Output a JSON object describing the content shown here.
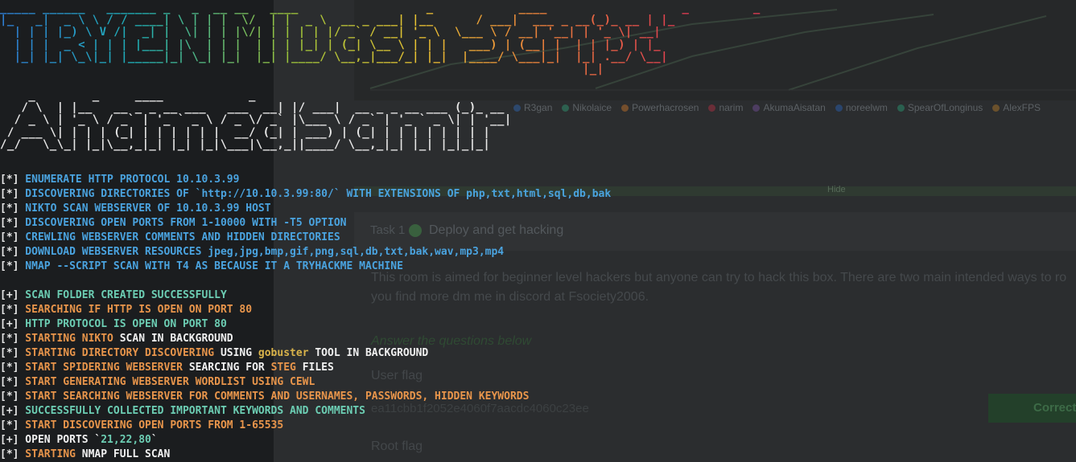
{
  "banner": {
    "line1": "_____ ______   _______ _   _  __ __   ____                  _            ____                   _         _",
    "line2": "|_   _|  _ \\ \\ / / ____| \\ | | |  \\/  | |  _ \\  __ _ ___| |__      / ___|  ___ _ __(_)_ __ | |_",
    "line3": "  | | | |_) \\ V /|  _| |  \\| | | |\\/| | | | | |/ _` / __| '_ \\  \\___ \\ / __| '__| | '_ \\| __|",
    "line4": "  | | |  _ < | | | |___| |\\  | | |  | | | |_| | (_| \\__ \\ | | |   ___) | (__| |  | | |_) | |_",
    "line5": "  |_| |_| \\_\\|_| |_____|_| \\_| |_|  |_| |____/ \\__,_|___/_| |_|  |____/ \\___|_|  |_| .__/ \\__|",
    "line6": "                                                                                  |_|",
    "art2": "    _        _     ____            _\n   / \\  | |__   __ _ _ __ ___   ___  __| |/ ___|  __ _ _ __ ___ (_)_ __\n  / _ \\ | '_ \\ / _` | '_ ` _ \\ / _ \\/ _` |\\___ \\ / _` | '_ ` _ \\| | '__|\n / ___ \\| | | | (_| | | | | | |  __/ (_| | ___) | (_| | | | | | | | |\n/_/   \\_\\_| |_|\\__,_|_| |_| |_|\\___|\\__,_||____/ \\__,_|_| |_| |_|_|_|"
  },
  "terminal": {
    "group1": [
      {
        "prefix": "[*]",
        "segments": [
          {
            "text": " ENUMERATE HTTP PROTOCOL 10.10.3.99",
            "color": "blue"
          }
        ]
      },
      {
        "prefix": "[*]",
        "segments": [
          {
            "text": " DISCOVERING DIRECTORIES OF `http://10.10.3.99:80/` WITH EXTENSIONS OF php,txt,html,sql,db,bak",
            "color": "blue"
          }
        ]
      },
      {
        "prefix": "[*]",
        "segments": [
          {
            "text": " NIKTO SCAN WEBSERVER OF 10.10.3.99 HOST",
            "color": "blue"
          }
        ]
      },
      {
        "prefix": "[*]",
        "segments": [
          {
            "text": " DISCOVERING OPEN PORTS FROM 1-10000 WITH -T5 OPTION",
            "color": "blue"
          }
        ]
      },
      {
        "prefix": "[*]",
        "segments": [
          {
            "text": " CREWLING WEBSERVER COMMENTS AND HIDDEN DIRECTORIES",
            "color": "blue"
          }
        ]
      },
      {
        "prefix": "[*]",
        "segments": [
          {
            "text": " DOWNLOAD WEBSERVER RESOURCES jpeg,jpg,bmp,gif,png,sql,db,txt,bak,wav,mp3,mp4",
            "color": "blue"
          }
        ]
      },
      {
        "prefix": "[*]",
        "segments": [
          {
            "text": " NMAP --SCRIPT SCAN WITH T4 AS BECAUSE IT A TRYHACKME MACHINE",
            "color": "blue"
          }
        ]
      }
    ],
    "group2": [
      {
        "prefix": "[+]",
        "segments": [
          {
            "text": " SCAN FOLDER CREATED SUCCESSFULLY",
            "color": "cyan"
          }
        ]
      },
      {
        "prefix": "[*]",
        "segments": [
          {
            "text": " SEARCHING IF HTTP IS OPEN ON PORT 80",
            "color": "orange"
          }
        ]
      },
      {
        "prefix": "[+]",
        "segments": [
          {
            "text": " HTTP PROTOCOL IS OPEN ON PORT 80",
            "color": "cyan"
          }
        ]
      },
      {
        "prefix": "[*]",
        "segments": [
          {
            "text": " STARTING NIKTO ",
            "color": "orange"
          },
          {
            "text": "SCAN IN BACKGROUND",
            "color": "white"
          }
        ]
      },
      {
        "prefix": "[*]",
        "segments": [
          {
            "text": " STARTING DIRECTORY DISCOVERING ",
            "color": "orange"
          },
          {
            "text": "USING ",
            "color": "white"
          },
          {
            "text": "gobuster",
            "color": "yellow"
          },
          {
            "text": " TOOL IN BACKGROUND",
            "color": "white"
          }
        ]
      },
      {
        "prefix": "[*]",
        "segments": [
          {
            "text": " START SPIDERING WEBSERVER ",
            "color": "orange"
          },
          {
            "text": "SEARCING FOR ",
            "color": "white"
          },
          {
            "text": "STEG",
            "color": "orange"
          },
          {
            "text": " FILES",
            "color": "white"
          }
        ]
      },
      {
        "prefix": "[*]",
        "segments": [
          {
            "text": " START GENERATING WEBSERVER WORDLIST USING CEWL",
            "color": "orange"
          }
        ]
      },
      {
        "prefix": "[*]",
        "segments": [
          {
            "text": " START SEARCHING WEBSERVER FOR COMMENTS AND USERNAMES, PASSWORDS, HIDDEN KEYWORDS",
            "color": "orange"
          }
        ]
      },
      {
        "prefix": "[+]",
        "segments": [
          {
            "text": " SUCCESSFULLY COLLECTED IMPORTANT KEYWORDS AND COMMENTS",
            "color": "cyan"
          }
        ]
      },
      {
        "prefix": "[*]",
        "segments": [
          {
            "text": " START DISCOVERING OPEN PORTS FROM 1-65535",
            "color": "orange"
          }
        ]
      },
      {
        "prefix": "[+]",
        "segments": [
          {
            "text": " OPEN PORTS `",
            "color": "white"
          },
          {
            "text": "21,22,80",
            "color": "cyan"
          },
          {
            "text": "`",
            "color": "white"
          }
        ]
      },
      {
        "prefix": "[*]",
        "segments": [
          {
            "text": " STARTING ",
            "color": "orange"
          },
          {
            "text": "NMAP FULL SCAN",
            "color": "white"
          }
        ]
      }
    ]
  },
  "background_page": {
    "legend": [
      {
        "label": "R3gan",
        "color": "#2f5fa0"
      },
      {
        "label": "Nikolaice",
        "color": "#2f8a6a"
      },
      {
        "label": "Powerhacrosen",
        "color": "#b06a2a"
      },
      {
        "label": "narim",
        "color": "#a03040"
      },
      {
        "label": "AkumaAisatan",
        "color": "#6a4a8a"
      },
      {
        "label": "noreelwm",
        "color": "#2a5aa0"
      },
      {
        "label": "SpearOfLonginus",
        "color": "#2a8a6a"
      },
      {
        "label": "AlexFPS",
        "color": "#a0702a"
      }
    ],
    "hint": "Hide",
    "task_number": "Task 1",
    "task_title": "Deploy and get hacking",
    "description": "This room is aimed for beginner level hackers but anyone can try to hack this box. There are two main intended ways to ro you find more dm me in discord at Fsociety2006.",
    "answer_hint": "Answer the questions below",
    "user_flag_label": "User flag",
    "user_flag_value": "ea11cbb1f2052e4060f7aacdc4060c23ee",
    "correct_label": "Correct",
    "root_flag_label": "Root flag"
  }
}
